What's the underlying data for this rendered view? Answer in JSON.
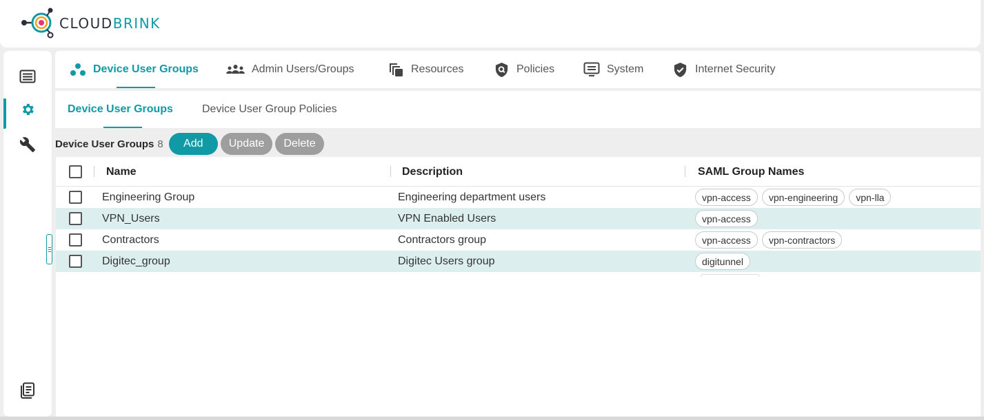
{
  "brand": {
    "logo_text_part1": "CLOUD",
    "logo_text_part2": "BRINK",
    "accent_color": "#0f9aa6"
  },
  "sidebar": {
    "items": [
      {
        "icon": "list-icon"
      },
      {
        "icon": "gear-icon",
        "active": true
      },
      {
        "icon": "wrench-icon"
      },
      {
        "icon": "document-icon"
      }
    ]
  },
  "main_tabs": [
    {
      "label": "Device User Groups",
      "icon": "device-groups-icon",
      "active": true
    },
    {
      "label": "Admin Users/Groups",
      "icon": "admin-users-icon"
    },
    {
      "label": "Resources",
      "icon": "resources-icon"
    },
    {
      "label": "Policies",
      "icon": "shield-search-icon"
    },
    {
      "label": "System",
      "icon": "system-monitor-icon"
    },
    {
      "label": "Internet Security",
      "icon": "shield-check-icon"
    }
  ],
  "sub_tabs": [
    {
      "label": "Device User Groups",
      "active": true
    },
    {
      "label": "Device User Group Policies"
    }
  ],
  "toolbar": {
    "title": "Device User Groups",
    "count": "8",
    "add_label": "Add",
    "update_label": "Update",
    "delete_label": "Delete"
  },
  "table": {
    "columns": [
      "Name",
      "Description",
      "SAML Group Names"
    ],
    "rows": [
      {
        "name": "Engineering Group",
        "description": "Engineering department users",
        "saml": [
          "vpn-access",
          "vpn-engineering",
          "vpn-lla"
        ]
      },
      {
        "name": "VPN_Users",
        "description": "VPN Enabled Users",
        "saml": [
          "vpn-access"
        ]
      },
      {
        "name": "Contractors",
        "description": "Contractors group",
        "saml": [
          "vpn-access",
          "vpn-contractors"
        ]
      },
      {
        "name": "Digitec_group",
        "description": "Digitec Users group",
        "saml": [
          "digitunnel"
        ]
      }
    ]
  }
}
